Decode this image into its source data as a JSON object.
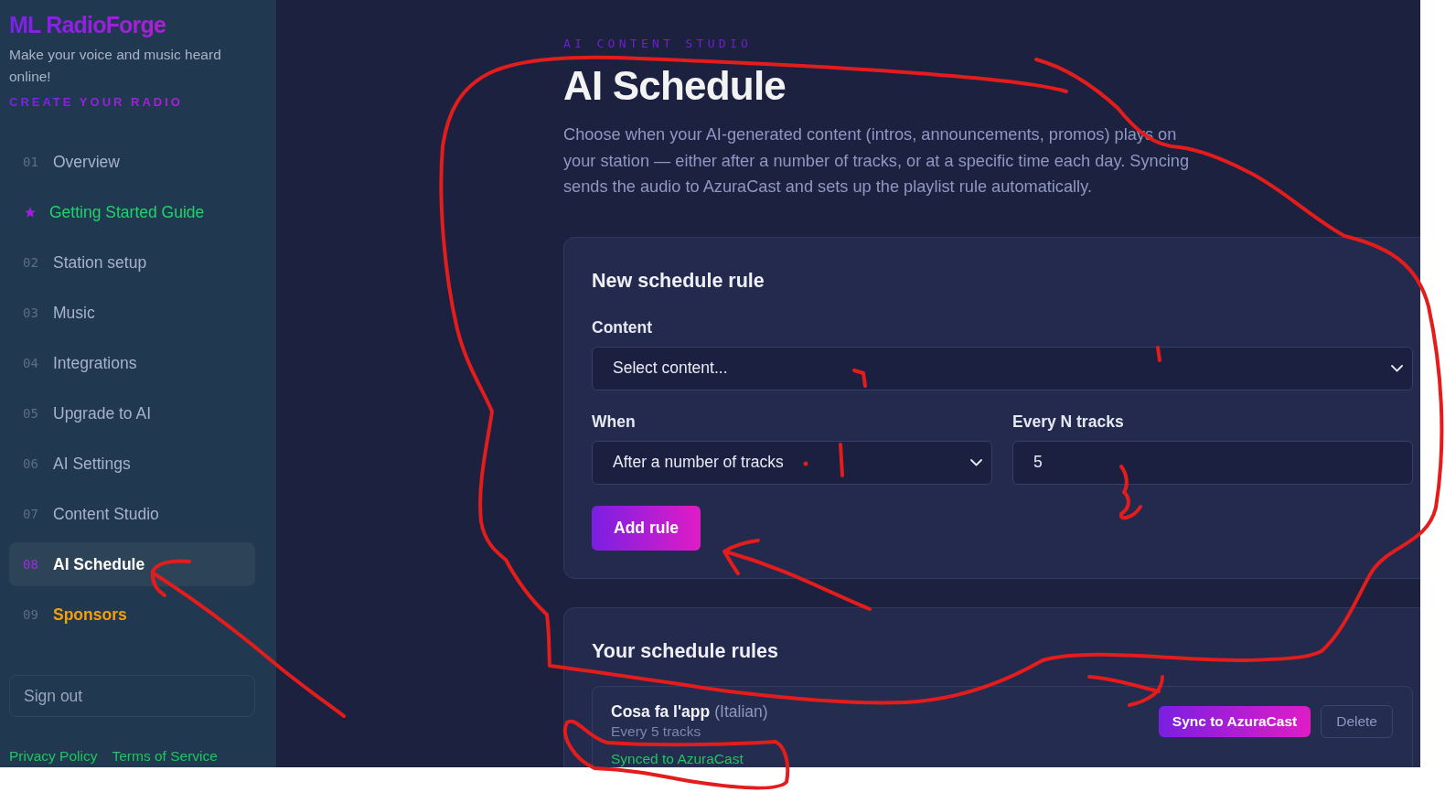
{
  "sidebar": {
    "brand": "ML RadioForge",
    "tagline": "Make your voice and music heard online!",
    "cta": "CREATE YOUR RADIO",
    "nav": [
      {
        "kind": "page",
        "number": "01",
        "label": "Overview",
        "selected": false
      },
      {
        "kind": "guide",
        "label": "Getting Started Guide",
        "selected": false
      },
      {
        "kind": "page",
        "number": "02",
        "label": "Station setup",
        "selected": false
      },
      {
        "kind": "page",
        "number": "03",
        "label": "Music",
        "selected": false
      },
      {
        "kind": "page",
        "number": "04",
        "label": "Integrations",
        "selected": false
      },
      {
        "kind": "page",
        "number": "05",
        "label": "Upgrade to AI",
        "selected": false
      },
      {
        "kind": "page",
        "number": "06",
        "label": "AI Settings",
        "selected": false
      },
      {
        "kind": "page",
        "number": "07",
        "label": "Content Studio",
        "selected": false
      },
      {
        "kind": "page",
        "number": "08",
        "label": "AI Schedule",
        "selected": true
      },
      {
        "kind": "sponsor",
        "number": "09",
        "label": "Sponsors",
        "selected": false
      }
    ],
    "sign_out": "Sign out",
    "footer_links": [
      "Privacy Policy",
      "Terms of Service"
    ]
  },
  "header": {
    "eyebrow": "AI CONTENT STUDIO",
    "title": "AI Schedule",
    "description": "Choose when your AI-generated content (intros, announcements, promos) plays on your station — either after a number of tracks, or at a specific time each day. Syncing sends the audio to AzuraCast and sets up the playlist rule automatically."
  },
  "new_rule_form": {
    "title": "New schedule rule",
    "rows": [
      {
        "fields": [
          {
            "kind": "select",
            "label": "Content",
            "placeholder": "Select content..."
          }
        ]
      },
      {
        "fields": [
          {
            "kind": "select",
            "label": "When",
            "value": "After a number of tracks"
          },
          {
            "kind": "number",
            "label": "Every N tracks",
            "value": "5"
          }
        ]
      }
    ],
    "submit": "Add rule"
  },
  "rules_list": {
    "title": "Your schedule rules",
    "rules": [
      {
        "name": "Cosa fa l'app",
        "language": "(Italian)",
        "trigger": "Every 5 tracks",
        "status": "Synced to AzuraCast",
        "actions": [
          {
            "kind": "primary",
            "label": "Sync to AzuraCast"
          },
          {
            "kind": "secondary",
            "label": "Delete"
          }
        ]
      }
    ]
  }
}
